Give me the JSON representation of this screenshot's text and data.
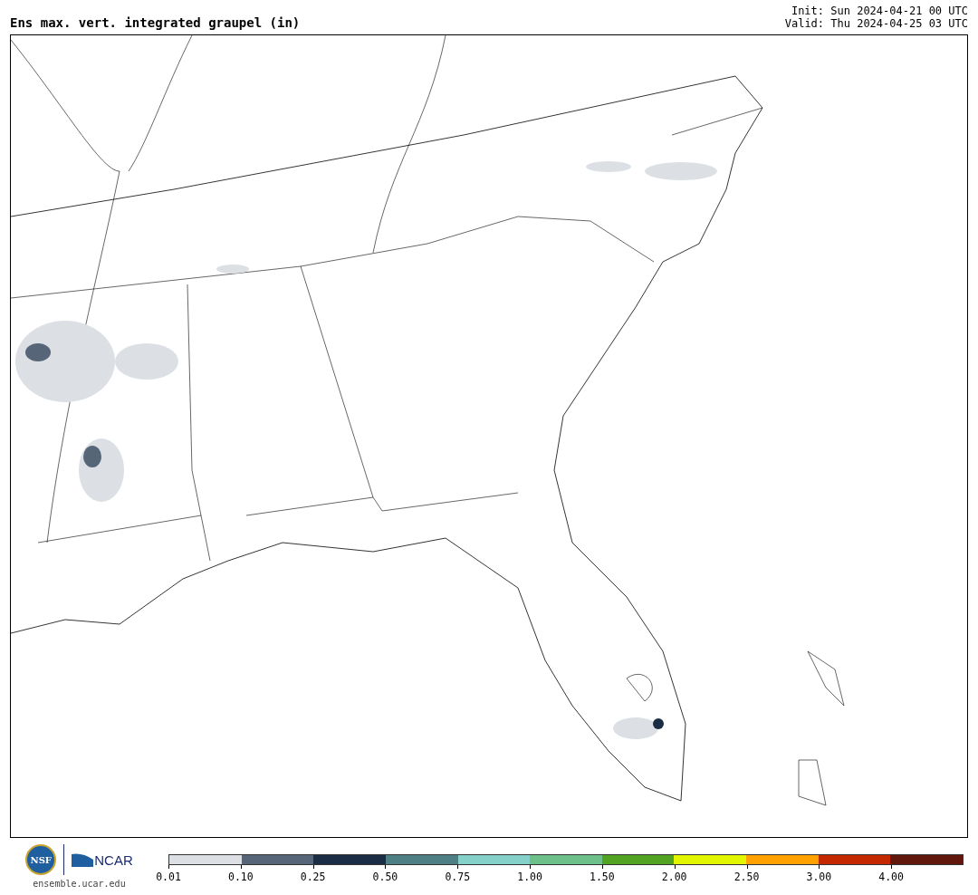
{
  "title": "Ens max. vert. integrated graupel (in)",
  "init": "Init: Sun 2024-04-21 00 UTC",
  "valid": "Valid: Thu 2024-04-25 03 UTC",
  "logos": {
    "nsf": "NSF",
    "ncar": "NCAR",
    "site": "ensemble.ucar.edu"
  },
  "colorbar": [
    {
      "color": "#dce0e4",
      "label": "0.01"
    },
    {
      "color": "#566578",
      "label": "0.10"
    },
    {
      "color": "#1b2c45",
      "label": "0.25"
    },
    {
      "color": "#4e7f84",
      "label": "0.50"
    },
    {
      "color": "#85d0c9",
      "label": "0.75"
    },
    {
      "color": "#6dc08a",
      "label": "1.00"
    },
    {
      "color": "#52a322",
      "label": "1.50"
    },
    {
      "color": "#e1f600",
      "label": "2.00"
    },
    {
      "color": "#ffa100",
      "label": "2.50"
    },
    {
      "color": "#c42800",
      "label": "3.00"
    },
    {
      "color": "#61170c",
      "label": "4.00"
    }
  ]
}
